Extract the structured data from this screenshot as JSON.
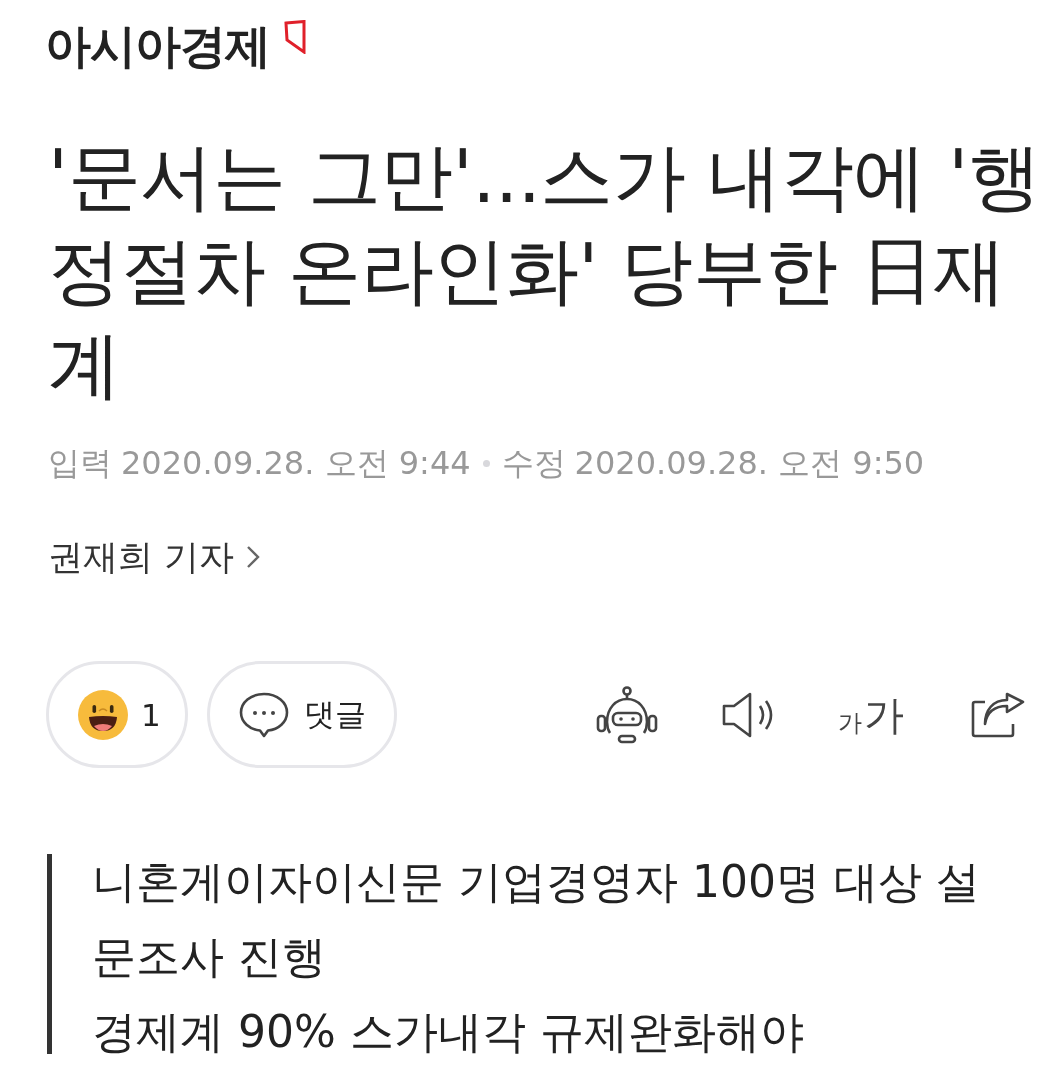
{
  "header": {
    "logo": "아시아경제"
  },
  "article": {
    "title": "'문서는 그만'...스가 내각에 '행정절차 온라인화' 당부한 日재계",
    "published_label": "입력",
    "published": "2020.09.28. 오전 9:44",
    "modified_label": "수정",
    "modified": "2020.09.28. 오전 9:50",
    "author": "권재희 기자"
  },
  "actions": {
    "reaction_count": "1",
    "comment_label": "댓글",
    "font_size_small": "가",
    "font_size_large": "가"
  },
  "summary": [
    "니혼게이자이신문 기업경영자 100명 대상 설문조사 진행",
    "경제계 90% 스가내각 규제완화해야"
  ]
}
